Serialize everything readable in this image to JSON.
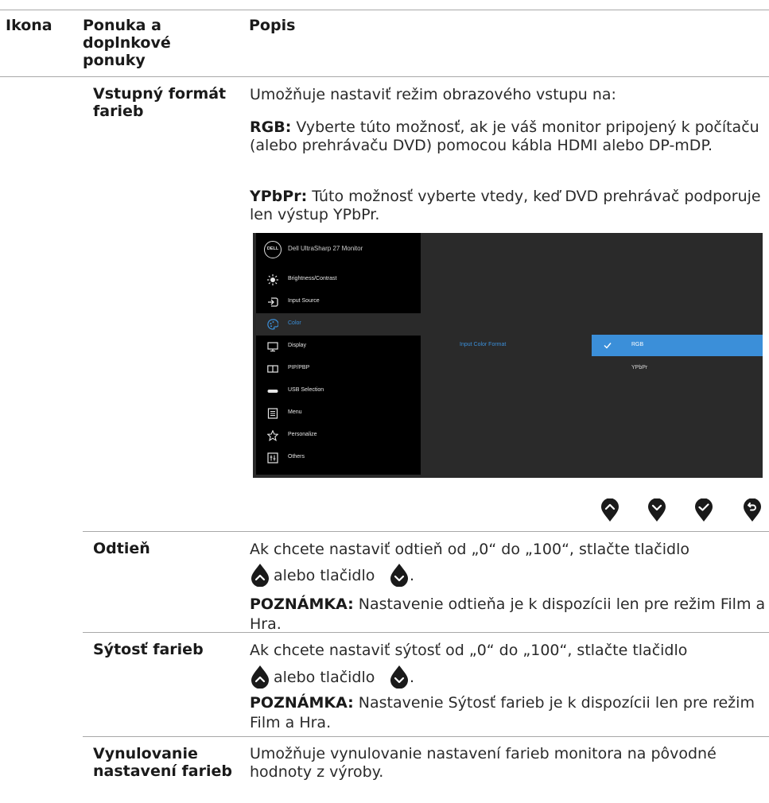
{
  "header": {
    "col_icon": "Ikona",
    "col_menu": "Ponuka a doplnkové ponuky",
    "col_desc": "Popis"
  },
  "rows": {
    "color_format": {
      "menu": "Vstupný formát farieb",
      "intro": "Umožňuje nastaviť režim obrazového vstupu na:",
      "rgb_label": "RGB:",
      "rgb_text": " Vyberte túto možnosť, ak je váš monitor pripojený k počítaču (alebo prehrávaču DVD) pomocou kábla HDMI alebo DP-mDP.",
      "ypbpr_label": "YPbPr:",
      "ypbpr_text": " Túto možnosť vyberte vtedy, keď DVD prehrávač podporuje len výstup YPbPr."
    },
    "hue": {
      "menu": "Odtieň",
      "text_a": "Ak chcete nastaviť odtieň od „0“ do „100“, stlačte tlačidlo",
      "text_b": "alebo tlačidlo",
      "text_c": ".",
      "note_label": "POZNÁMKA:",
      "note_text": " Nastavenie odtieňa je k dispozícii len pre režim Film a Hra."
    },
    "saturation": {
      "menu": "Sýtosť farieb",
      "text_a": "Ak chcete nastaviť sýtosť od „0“ do „100“, stlačte tlačidlo",
      "text_b": "alebo tlačidlo",
      "text_c": ".",
      "note_label": "POZNÁMKA:",
      "note_text": " Nastavenie Sýtosť farieb je k dispozícii len pre režim Film a Hra."
    },
    "reset": {
      "menu": "Vynulovanie nastavení farieb",
      "text": "Umožňuje vynulovanie nastavení farieb monitora na pôvodné hodnoty z výroby."
    }
  },
  "osd": {
    "title": "Dell UltraSharp 27 Monitor",
    "logo": "DELL",
    "menu_items": [
      {
        "label": "Brightness/Contrast",
        "icon": "brightness-icon"
      },
      {
        "label": "Input Source",
        "icon": "input-source-icon"
      },
      {
        "label": "Color",
        "icon": "color-palette-icon"
      },
      {
        "label": "Display",
        "icon": "display-icon"
      },
      {
        "label": "PIP/PBP",
        "icon": "pip-pbp-icon"
      },
      {
        "label": "USB Selection",
        "icon": "usb-icon"
      },
      {
        "label": "Menu",
        "icon": "menu-icon"
      },
      {
        "label": "Personalize",
        "icon": "star-icon"
      },
      {
        "label": "Others",
        "icon": "others-icon"
      }
    ],
    "submenu_label": "Input Color Format",
    "options": [
      "RGB",
      "YPbPr"
    ],
    "selected": "RGB",
    "highlight_color": "#3b8fd9"
  },
  "buttons": [
    "up-button-icon",
    "down-button-icon",
    "ok-button-icon",
    "back-button-icon"
  ]
}
